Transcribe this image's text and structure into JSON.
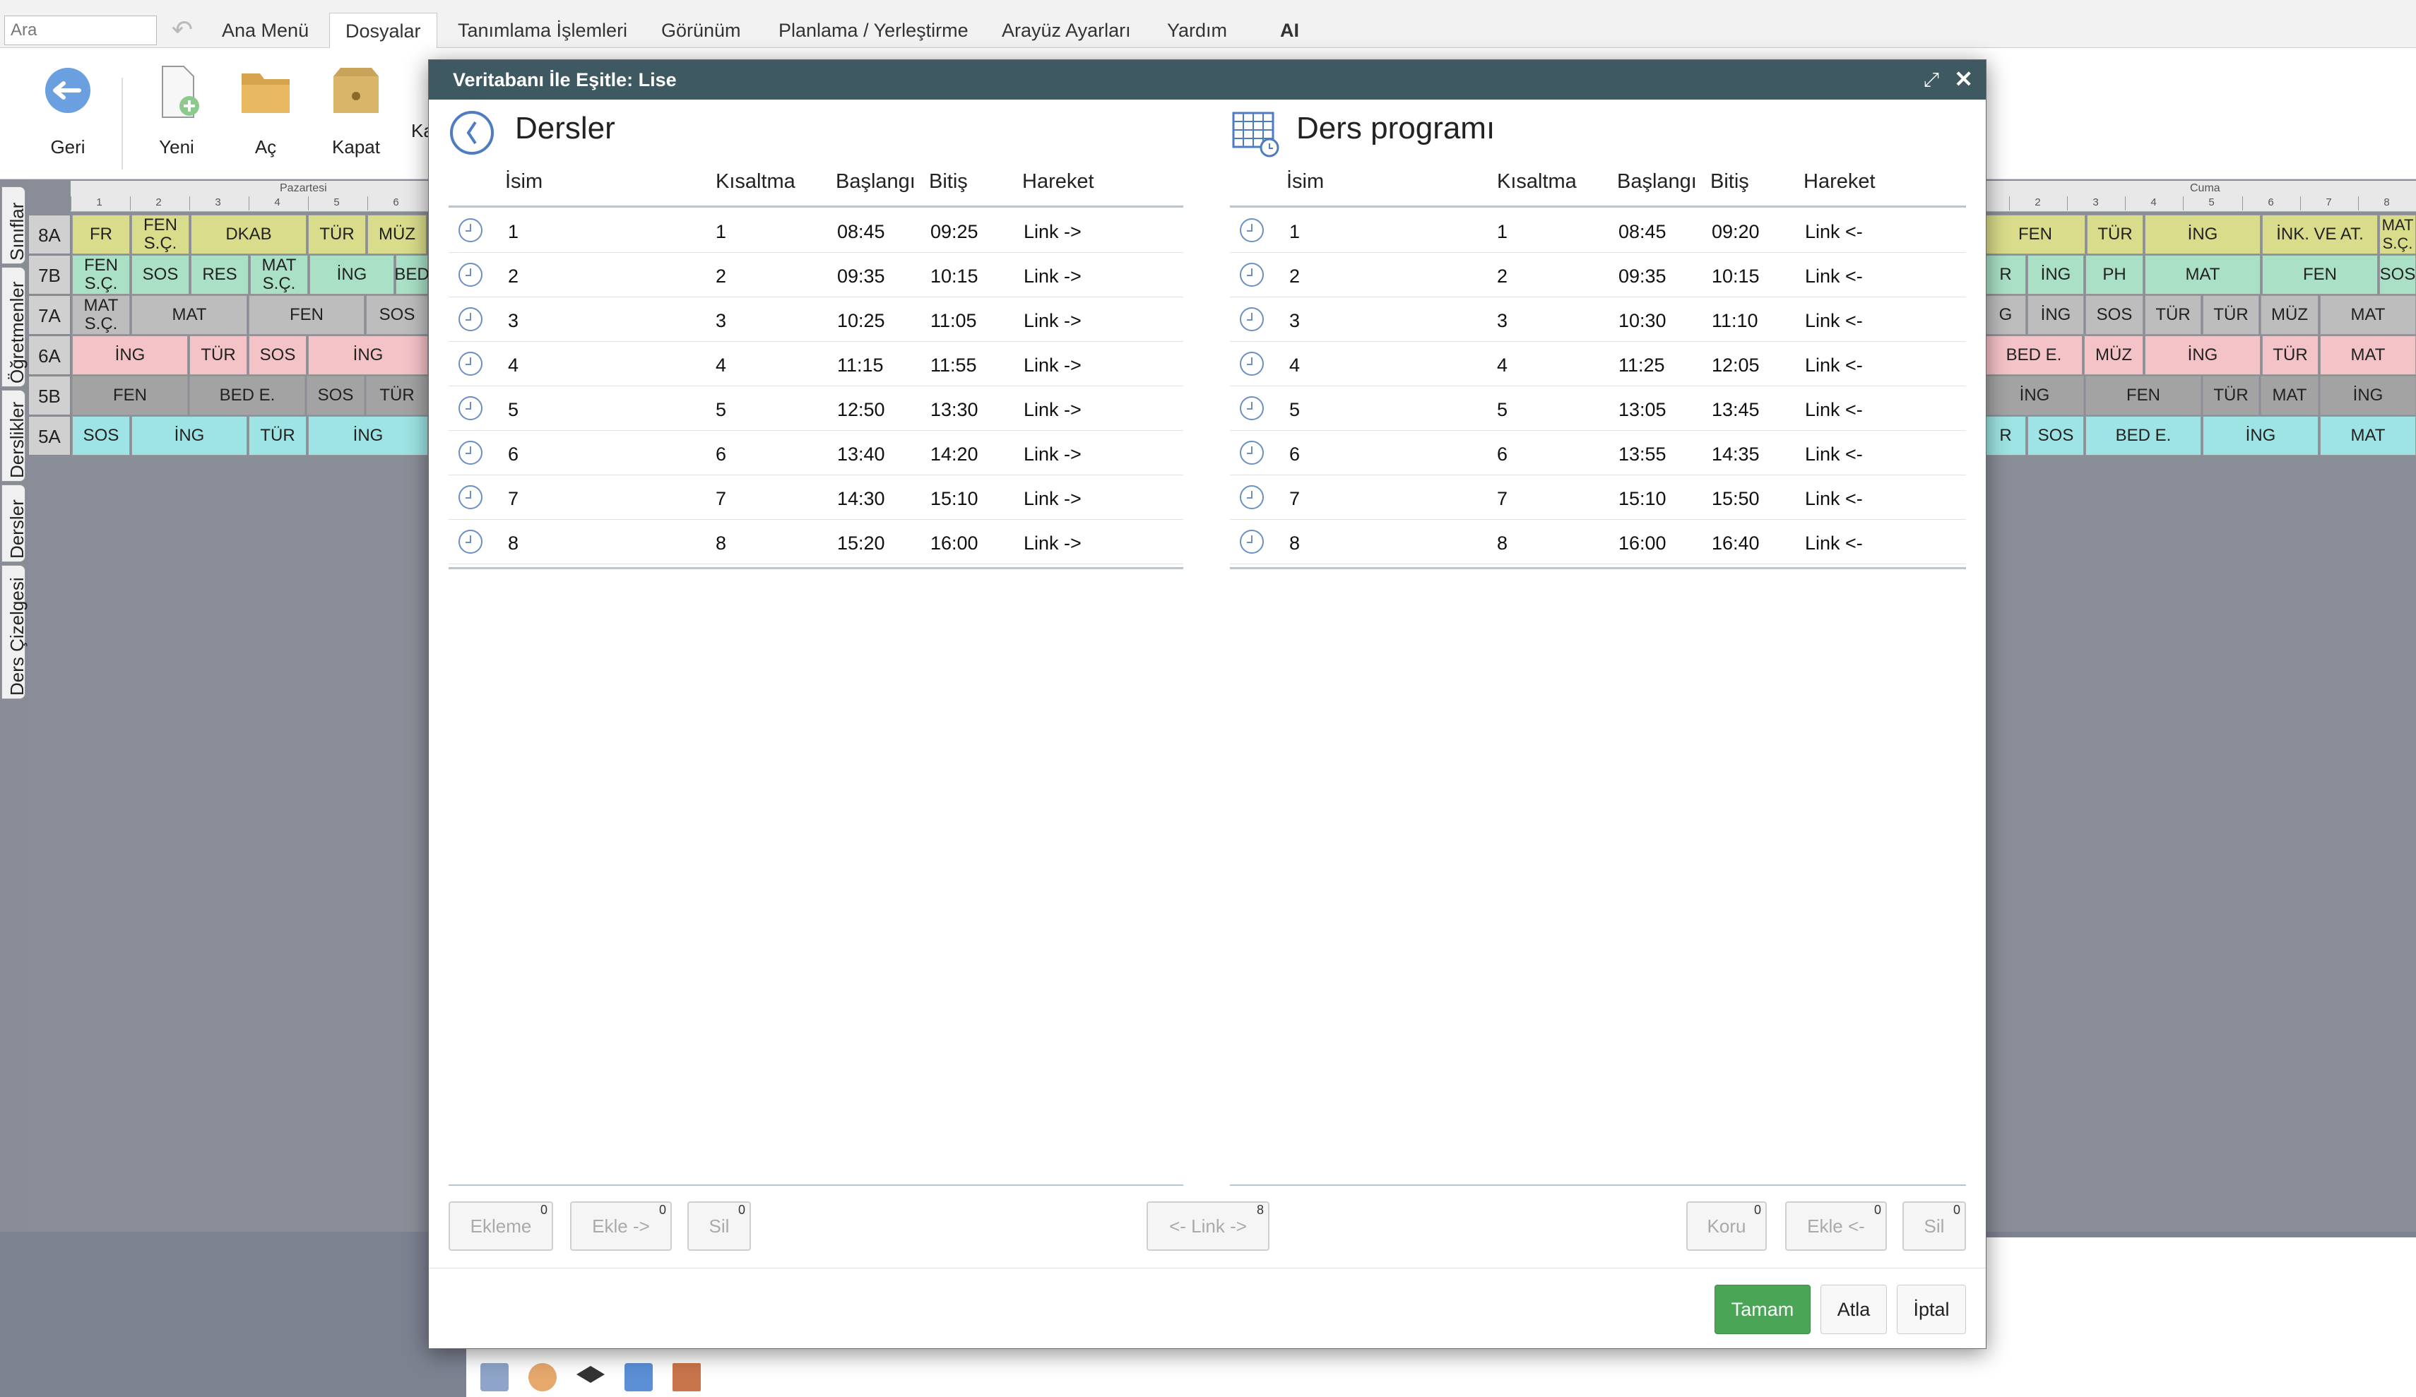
{
  "search": {
    "placeholder": "Ara"
  },
  "menu": [
    "Ana Menü",
    "Dosyalar",
    "Tanımlama İşlemleri",
    "Görünüm",
    "Planlama / Yerleştirme",
    "Arayüz Ayarları",
    "Yardım",
    "AI"
  ],
  "toolbar": {
    "back": "Geri",
    "new": "Yeni",
    "open": "Aç",
    "close": "Kapat",
    "extra": "Ka"
  },
  "sidetabs": [
    "Sınıflar",
    "Öğretmenler",
    "Derslikler",
    "Dersler",
    "Ders Çizelgesi"
  ],
  "grid": {
    "day_left": "Pazartesi",
    "day_right": "Cuma",
    "periods_left": [
      "1",
      "2",
      "3",
      "4",
      "5",
      "6"
    ],
    "periods_right": [
      "2",
      "3",
      "4",
      "5",
      "6",
      "7",
      "8"
    ],
    "rows": [
      {
        "label": "8A",
        "left": [
          "FR",
          "FEN S.Ç.",
          "DKAB",
          "TÜR",
          "MÜZ"
        ],
        "right": [
          "FEN",
          "TÜR",
          "İNG",
          "İNK. VE AT.",
          "MAT S.Ç."
        ]
      },
      {
        "label": "7B",
        "left": [
          "FEN S.Ç.",
          "SOS",
          "RES",
          "MAT S.Ç.",
          "İNG",
          "BED"
        ],
        "right": [
          "R",
          "İNG",
          "PH",
          "MAT",
          "FEN",
          "SOS"
        ]
      },
      {
        "label": "7A",
        "left": [
          "MAT S.Ç.",
          "MAT",
          "FEN",
          "SOS"
        ],
        "right": [
          "G",
          "İNG",
          "SOS",
          "TÜR",
          "TÜR",
          "MÜZ",
          "MAT"
        ]
      },
      {
        "label": "6A",
        "left": [
          "İNG",
          "TÜR",
          "SOS",
          "İNG"
        ],
        "right": [
          "BED E.",
          "MÜZ",
          "İNG",
          "TÜR",
          "MAT"
        ]
      },
      {
        "label": "5B",
        "left": [
          "FEN",
          "BED E.",
          "SOS",
          "TÜR"
        ],
        "right": [
          "İNG",
          "FEN",
          "TÜR",
          "MAT",
          "İNG"
        ]
      },
      {
        "label": "5A",
        "left": [
          "SOS",
          "İNG",
          "TÜR",
          "İNG"
        ],
        "right": [
          "R",
          "SOS",
          "BED E.",
          "İNG",
          "MAT"
        ]
      }
    ]
  },
  "dialog": {
    "title": "Veritabanı İle Eşitle: Lise",
    "left": {
      "title": "Dersler",
      "headers": [
        "İsim",
        "Kısaltma",
        "Başlangı",
        "Bitiş",
        "Hareket"
      ],
      "rows": [
        [
          "1",
          "1",
          "08:45",
          "09:25",
          "Link ->"
        ],
        [
          "2",
          "2",
          "09:35",
          "10:15",
          "Link ->"
        ],
        [
          "3",
          "3",
          "10:25",
          "11:05",
          "Link ->"
        ],
        [
          "4",
          "4",
          "11:15",
          "11:55",
          "Link ->"
        ],
        [
          "5",
          "5",
          "12:50",
          "13:30",
          "Link ->"
        ],
        [
          "6",
          "6",
          "13:40",
          "14:20",
          "Link ->"
        ],
        [
          "7",
          "7",
          "14:30",
          "15:10",
          "Link ->"
        ],
        [
          "8",
          "8",
          "15:20",
          "16:00",
          "Link ->"
        ]
      ]
    },
    "right": {
      "title": "Ders programı",
      "headers": [
        "İsim",
        "Kısaltma",
        "Başlangı",
        "Bitiş",
        "Hareket"
      ],
      "rows": [
        [
          "1",
          "1",
          "08:45",
          "09:20",
          "Link <-"
        ],
        [
          "2",
          "2",
          "09:35",
          "10:15",
          "Link <-"
        ],
        [
          "3",
          "3",
          "10:30",
          "11:10",
          "Link <-"
        ],
        [
          "4",
          "4",
          "11:25",
          "12:05",
          "Link <-"
        ],
        [
          "5",
          "5",
          "13:05",
          "13:45",
          "Link <-"
        ],
        [
          "6",
          "6",
          "13:55",
          "14:35",
          "Link <-"
        ],
        [
          "7",
          "7",
          "15:10",
          "15:50",
          "Link <-"
        ],
        [
          "8",
          "8",
          "16:00",
          "16:40",
          "Link <-"
        ]
      ]
    },
    "buttons": {
      "ekleme": {
        "label": "Ekleme",
        "count": "0"
      },
      "ekle_right": {
        "label": "Ekle ->",
        "count": "0"
      },
      "sil_left": {
        "label": "Sil",
        "count": "0"
      },
      "link": {
        "label": "<- Link ->",
        "count": "8"
      },
      "koru": {
        "label": "Koru",
        "count": "0"
      },
      "ekle_left": {
        "label": "Ekle <-",
        "count": "0"
      },
      "sil_right": {
        "label": "Sil",
        "count": "0"
      }
    },
    "footer": {
      "ok": "Tamam",
      "skip": "Atla",
      "cancel": "İptal"
    }
  },
  "colors": {
    "accent_green": "#4aa557",
    "title_bar": "#3f5962",
    "yellow": "#d9dc8a",
    "green": "#a9e0c6",
    "gray": "#bdbdbd",
    "pink": "#f4c3c8",
    "cyan": "#9ee4e4"
  }
}
